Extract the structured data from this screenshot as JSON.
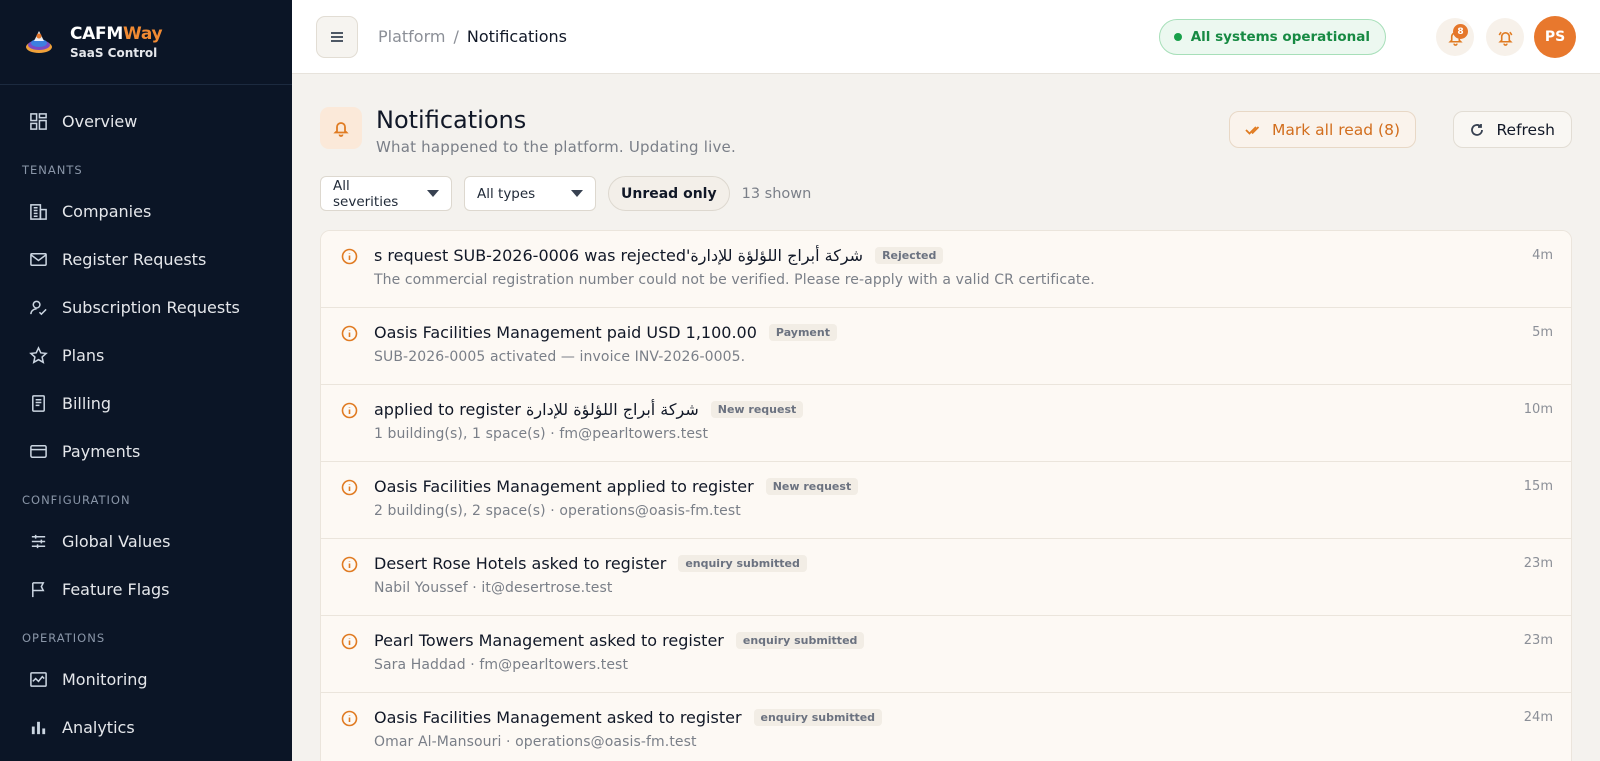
{
  "brand": {
    "name_a": "CAFM",
    "name_b": "Way",
    "subtitle": "SaaS Control"
  },
  "sidebar": {
    "items": [
      {
        "label": "Overview",
        "icon": "dashboard-icon"
      },
      {
        "section": "TENANTS"
      },
      {
        "label": "Companies",
        "icon": "building-icon"
      },
      {
        "label": "Register Requests",
        "icon": "mail-inbox-icon"
      },
      {
        "label": "Subscription Requests",
        "icon": "user-check-icon"
      },
      {
        "label": "Plans",
        "icon": "star-icon"
      },
      {
        "label": "Billing",
        "icon": "receipt-icon"
      },
      {
        "label": "Payments",
        "icon": "credit-card-icon"
      },
      {
        "section": "CONFIGURATION"
      },
      {
        "label": "Global Values",
        "icon": "sliders-icon"
      },
      {
        "label": "Feature Flags",
        "icon": "flag-icon"
      },
      {
        "section": "OPERATIONS"
      },
      {
        "label": "Monitoring",
        "icon": "activity-icon"
      },
      {
        "label": "Analytics",
        "icon": "bar-chart-icon"
      }
    ]
  },
  "topbar": {
    "breadcrumb": {
      "parent": "Platform",
      "separator": "/",
      "current": "Notifications"
    },
    "status": "All systems operational",
    "notification_count": "8",
    "avatar_initials": "PS"
  },
  "page": {
    "title": "Notifications",
    "subtitle": "What happened to the platform. Updating live.",
    "mark_all_read": "Mark all read (8)",
    "refresh": "Refresh"
  },
  "filters": {
    "severity": "All severities",
    "type": "All types",
    "unread_toggle": "Unread only",
    "shown_count": "13 shown"
  },
  "notifications": [
    {
      "title": "شركة أبراج اللؤلؤة للإدارة's request SUB-2026-0006 was rejected",
      "tag": "Rejected",
      "description": "The commercial registration number could not be verified. Please re-apply with a valid CR certificate.",
      "time": "4m"
    },
    {
      "title": "Oasis Facilities Management paid USD 1,100.00",
      "tag": "Payment",
      "description": "SUB-2026-0005 activated — invoice INV-2026-0005.",
      "time": "5m"
    },
    {
      "title": "شركة أبراج اللؤلؤة للإدارة applied to register",
      "tag": "New request",
      "description": "1 building(s), 1 space(s) · fm@pearltowers.test",
      "time": "10m"
    },
    {
      "title": "Oasis Facilities Management applied to register",
      "tag": "New request",
      "description": "2 building(s), 2 space(s) · operations@oasis-fm.test",
      "time": "15m"
    },
    {
      "title": "Desert Rose Hotels asked to register",
      "tag": "enquiry submitted",
      "description": "Nabil Youssef · it@desertrose.test",
      "time": "23m"
    },
    {
      "title": "Pearl Towers Management asked to register",
      "tag": "enquiry submitted",
      "description": "Sara Haddad · fm@pearltowers.test",
      "time": "23m"
    },
    {
      "title": "Oasis Facilities Management asked to register",
      "tag": "enquiry submitted",
      "description": "Omar Al-Mansouri · operations@oasis-fm.test",
      "time": "24m"
    }
  ]
}
